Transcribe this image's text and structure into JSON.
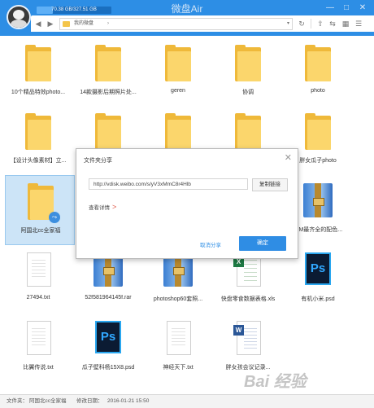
{
  "app": {
    "title": "微盘Air"
  },
  "quota": {
    "text": "70.38 GB/327.51 GB",
    "used_fraction": 0.215
  },
  "window_controls": [
    "—",
    "□",
    "✕"
  ],
  "toolbar": {
    "path": "我的微盘",
    "chevron": "›",
    "dropdown": "▾"
  },
  "files": [
    {
      "name": "10个精品特效photo...",
      "type": "folder"
    },
    {
      "name": "14款摄影后期照片处...",
      "type": "folder"
    },
    {
      "name": "geren",
      "type": "folder"
    },
    {
      "name": "协调",
      "type": "folder"
    },
    {
      "name": "photo",
      "type": "folder"
    },
    {
      "name": "【设计头像素材】立...",
      "type": "folder"
    },
    {
      "name": "",
      "type": "folder"
    },
    {
      "name": "",
      "type": "folder"
    },
    {
      "name": "",
      "type": "folder"
    },
    {
      "name": "胖女瓜子photo",
      "type": "folder"
    },
    {
      "name": "阿国北cc全家福",
      "type": "shared-folder",
      "selected": true
    },
    {
      "name": ".BM最齐全的配色...",
      "type": "rar"
    },
    {
      "name": "27494.txt",
      "type": "txt"
    },
    {
      "name": "52f581964145f.rar",
      "type": "rar"
    },
    {
      "name": "photoshop60套照...",
      "type": "rar"
    },
    {
      "name": "快盘零食数据表格.xls",
      "type": "xls"
    },
    {
      "name": "有机小米.psd",
      "type": "psd"
    },
    {
      "name": "比翼传说.txt",
      "type": "txt"
    },
    {
      "name": "瓜子壁科杨15X8.psd",
      "type": "psd"
    },
    {
      "name": "神经天下.txt",
      "type": "txt"
    },
    {
      "name": "胖女孩会议记录...",
      "type": "doc"
    }
  ],
  "dialog": {
    "title": "文件夹分享",
    "close": "✕",
    "link": "http://vdisk.weibo.com/s/yV3xMmC8r4Hlb",
    "copy_button": "复制链接",
    "detail_link": "查看详情",
    "detail_arrow": ">",
    "cancel": "取消分享",
    "ok": "确定"
  },
  "status": {
    "name_label": "文件夹：",
    "name_value": "阿国北cc全家福",
    "date_label": "修改日期：",
    "date_value": "2016-01-21 15:50"
  },
  "watermark": "Bai 经验"
}
